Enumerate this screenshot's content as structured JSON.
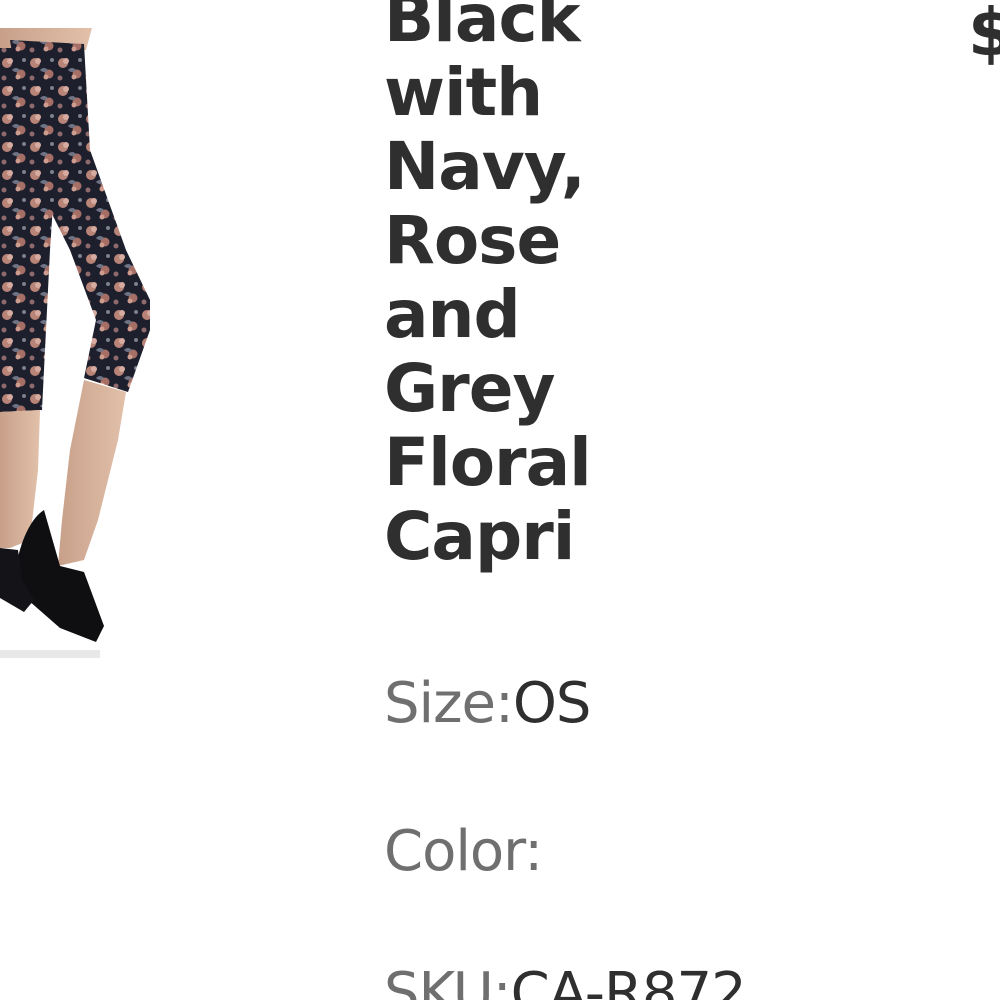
{
  "product": {
    "title": "Black with Navy, Rose and Grey Floral Capri",
    "price_symbol": "$",
    "image_icon": "floral-capri-leggings-photo",
    "size": {
      "label": "Size:",
      "value": "OS"
    },
    "color": {
      "label": "Color:",
      "value": ""
    },
    "sku": {
      "label": "SKU:",
      "value": "CA-R872"
    }
  },
  "colors": {
    "text_dark": "#2f2f2f",
    "text_label": "#6f6f6f",
    "background": "#ffffff"
  }
}
